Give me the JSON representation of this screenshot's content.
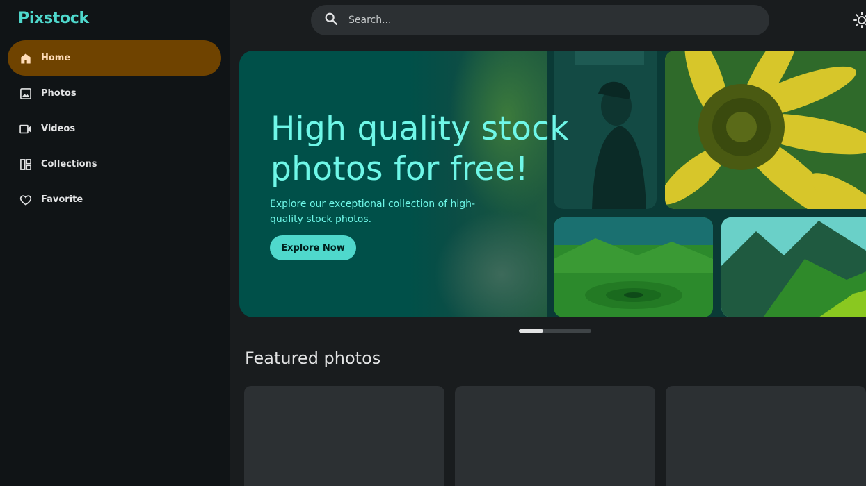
{
  "app": {
    "logo": "Pixstock"
  },
  "sidebar": {
    "items": [
      {
        "label": "Home",
        "icon": "home-icon",
        "active": true
      },
      {
        "label": "Photos",
        "icon": "image-icon",
        "active": false
      },
      {
        "label": "Videos",
        "icon": "video-icon",
        "active": false
      },
      {
        "label": "Collections",
        "icon": "collections-icon",
        "active": false
      },
      {
        "label": "Favorite",
        "icon": "heart-icon",
        "active": false
      }
    ]
  },
  "search": {
    "placeholder": "Search..."
  },
  "hero": {
    "title": "High quality stock photos for free!",
    "subtitle": "Explore our exceptional collection of high-quality stock photos.",
    "button_label": "Explore Now"
  },
  "carousel": {
    "progress": 0.34
  },
  "featured": {
    "title": "Featured photos"
  },
  "colors": {
    "accent": "#4fd8cc",
    "active_nav_bg": "#6f4300",
    "background": "#191c1e",
    "sidebar_bg": "#101416"
  }
}
